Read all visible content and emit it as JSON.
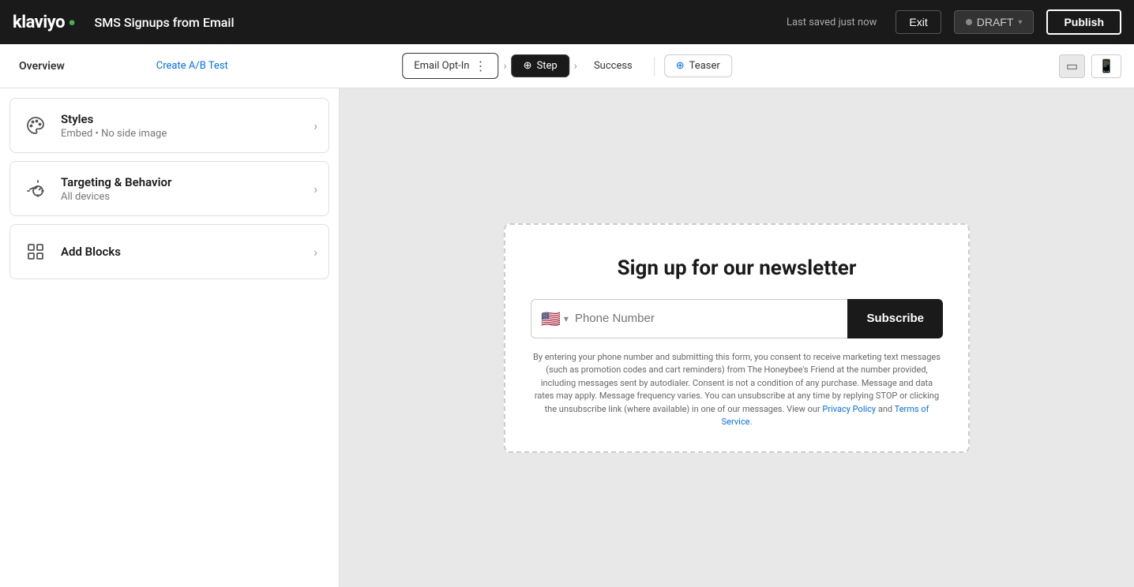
{
  "topnav": {
    "logo": "klaviyo",
    "page_title": "SMS Signups from Email",
    "last_saved": "Last saved just now",
    "exit_label": "Exit",
    "draft_label": "DRAFT",
    "publish_label": "Publish"
  },
  "stepnav": {
    "overview_label": "Overview",
    "create_ab_label": "Create A/B Test",
    "steps": [
      {
        "id": "email-opt-in",
        "label": "Email Opt-In",
        "state": "outlined"
      },
      {
        "id": "step",
        "label": "Step",
        "state": "active"
      },
      {
        "id": "success",
        "label": "Success",
        "state": "plain"
      },
      {
        "id": "teaser",
        "label": "Teaser",
        "state": "teaser"
      }
    ]
  },
  "sidebar": {
    "cards": [
      {
        "id": "styles",
        "title": "Styles",
        "subtitle": "Embed • No side image",
        "icon": "palette"
      },
      {
        "id": "targeting",
        "title": "Targeting & Behavior",
        "subtitle": "All devices",
        "icon": "targeting"
      },
      {
        "id": "add-blocks",
        "title": "Add Blocks",
        "subtitle": "",
        "icon": "blocks"
      }
    ]
  },
  "canvas": {
    "form": {
      "headline": "Sign up for our newsletter",
      "phone_placeholder": "Phone Number",
      "subscribe_label": "Subscribe",
      "disclaimer": "By entering your phone number and submitting this form, you consent to receive marketing text messages (such as promotion codes and cart reminders) from The Honeybee's Friend at the number provided, including messages sent by autodialer. Consent is not a condition of any purchase. Message and data rates may apply. Message frequency varies. You can unsubscribe at any time by replying STOP or clicking the unsubscribe link (where available) in one of our messages. View our ",
      "privacy_label": "Privacy Policy",
      "and_text": " and ",
      "terms_label": "Terms of Service",
      "end_text": "."
    }
  }
}
